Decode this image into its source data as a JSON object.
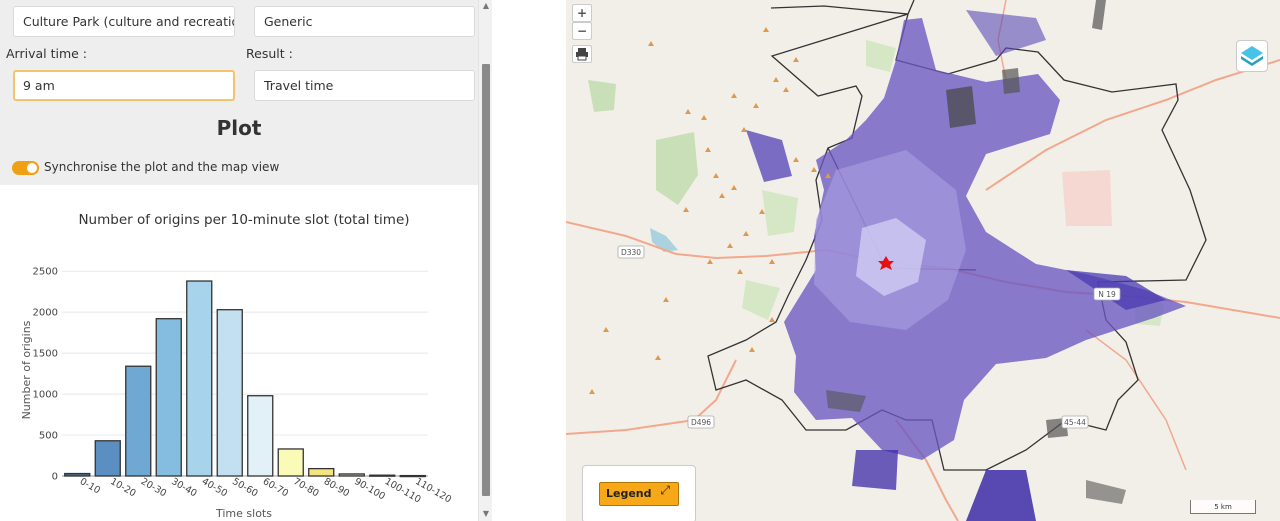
{
  "panel": {
    "destination_value": "Culture Park (culture and recreation",
    "mode_value": "Generic",
    "arrival_label": "Arrival time :",
    "arrival_value": "9 am",
    "result_label": "Result :",
    "result_value": "Travel time",
    "plot_heading": "Plot",
    "sync_label": "Synchronise the plot and the map view",
    "sync_enabled": true
  },
  "chart_data": {
    "type": "bar",
    "title": "Number of origins per 10-minute slot (total time)",
    "xlabel": "Time slots",
    "ylabel": "Number of origins",
    "categories": [
      "0-10",
      "10-20",
      "20-30",
      "30-40",
      "40-50",
      "50-60",
      "60-70",
      "70-80",
      "80-90",
      "90-100",
      "100-110",
      "110-120"
    ],
    "values": [
      30,
      430,
      1340,
      1920,
      2380,
      2030,
      980,
      330,
      90,
      25,
      10,
      5
    ],
    "yticks": [
      0,
      500,
      1000,
      1500,
      2000,
      2500
    ],
    "ylim": [
      0,
      2600
    ],
    "grid": true,
    "colors": [
      "#4d6e8c",
      "#5b8fc2",
      "#6ea8d3",
      "#85bde0",
      "#a7d4ea",
      "#c3e0f0",
      "#e2f1f8",
      "#fbfbb8",
      "#f4e480",
      "#ccc9a0",
      "#bdbdbd",
      "#bdbdbd"
    ]
  },
  "map": {
    "zoom_in_label": "+",
    "zoom_out_label": "−",
    "print_icon": "print-icon",
    "layers_icon": "layers-icon",
    "legend_label": "Legend",
    "expand_icon": "expand-icon",
    "scale_label": "5 km",
    "road_labels": [
      "D330",
      "D496",
      "45-44",
      "N 19"
    ],
    "accent_color": "#f7a818",
    "catchment_color": "#5b4bb8"
  }
}
